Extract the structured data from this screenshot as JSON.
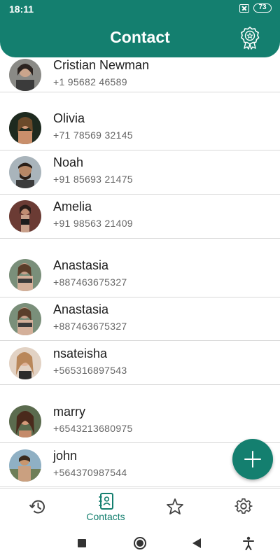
{
  "status_bar": {
    "time": "18:11",
    "battery": "73"
  },
  "header": {
    "title": "Contact",
    "icon": "award-icon"
  },
  "contacts": [
    {
      "name": "Cristian Newman",
      "phone": "+1 95682 46589"
    },
    {
      "name": "Olivia",
      "phone": "+71 78569 32145"
    },
    {
      "name": "Noah",
      "phone": "+91 85693 21475"
    },
    {
      "name": "Amelia",
      "phone": "+91 98563 21409"
    },
    {
      "name": "Anastasia",
      "phone": "+887463675327"
    },
    {
      "name": "Anastasia",
      "phone": "+887463675327"
    },
    {
      "name": "nsateisha",
      "phone": "+565316897543"
    },
    {
      "name": "marry",
      "phone": "+6543213680975"
    },
    {
      "name": "john",
      "phone": "+564370987544"
    }
  ],
  "fab": {
    "icon": "plus-icon"
  },
  "bottom_nav": {
    "items": [
      {
        "icon": "history-icon",
        "label": ""
      },
      {
        "icon": "contacts-icon",
        "label": "Contacts",
        "active": true
      },
      {
        "icon": "star-icon",
        "label": ""
      },
      {
        "icon": "settings-icon",
        "label": ""
      }
    ]
  },
  "colors": {
    "primary": "#147f6f",
    "text": "#1e1e1e",
    "secondary_text": "#666666",
    "divider": "#d9d9d9"
  }
}
